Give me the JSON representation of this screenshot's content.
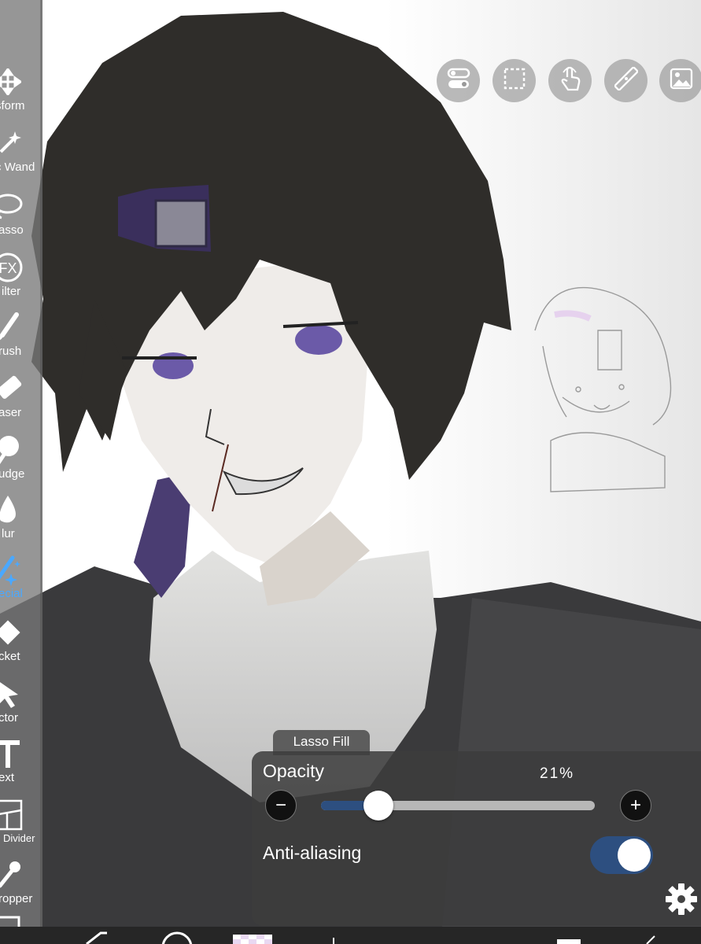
{
  "toolbar": {
    "tools": [
      {
        "label": "sform",
        "icon": "move-arrows-icon"
      },
      {
        "label": "c Wand",
        "icon": "magic-wand-icon"
      },
      {
        "label": "asso",
        "icon": "lasso-icon"
      },
      {
        "label": "ilter",
        "icon": "fx-filter-icon"
      },
      {
        "label": "rush",
        "icon": "brush-icon"
      },
      {
        "label": "aser",
        "icon": "eraser-icon"
      },
      {
        "label": "udge",
        "icon": "smudge-icon"
      },
      {
        "label": "lur",
        "icon": "blur-drop-icon"
      },
      {
        "label": "ecial",
        "icon": "special-wand-icon",
        "active": true
      },
      {
        "label": "cket",
        "icon": "bucket-icon"
      },
      {
        "label": "ctor",
        "icon": "select-arrow-icon"
      },
      {
        "label": "ext",
        "icon": "text-icon"
      },
      {
        "label": "Divider",
        "icon": "frame-divider-icon"
      },
      {
        "label": "ropper",
        "icon": "eyedropper-icon"
      }
    ],
    "active_color": "#4aa8ff"
  },
  "top_icons": [
    "toggle-settings-icon",
    "selection-icon",
    "touch-icon",
    "ruler-icon",
    "image-icon"
  ],
  "lasso_fill": {
    "tab_label": "Lasso Fill",
    "opacity_label": "Opacity",
    "opacity_value": "21%",
    "opacity": 0.21,
    "minus": "−",
    "plus": "+",
    "anti_aliasing_label": "Anti-aliasing",
    "anti_aliasing_on": true,
    "accent_color": "#2d4f80"
  }
}
